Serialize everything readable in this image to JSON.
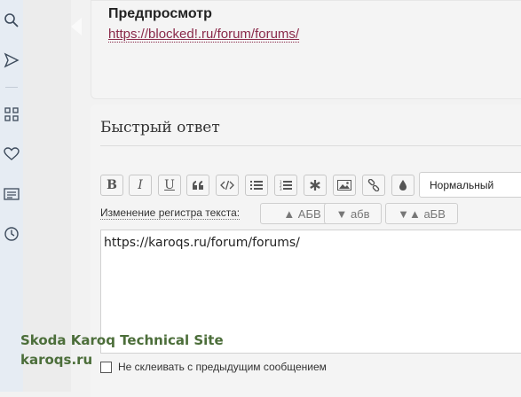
{
  "sidebar": {
    "icons": [
      "search-icon",
      "send-icon",
      "grid-icon",
      "heart-icon",
      "newspaper-icon",
      "clock-icon"
    ]
  },
  "preview": {
    "title": "Предпросмотр",
    "link": "https://blocked!.ru/forum/forums/"
  },
  "quick_reply": {
    "title": "Быстрый ответ",
    "toolbar": {
      "bold": "B",
      "italic": "I",
      "underline": "U",
      "format_select": "Нормальный"
    },
    "case_change_label": "Изменение регистра текста:",
    "case_buttons": [
      "▲ АБВ",
      "▼ абв",
      "▼▲ аБВ"
    ],
    "editor_value": "https://karoqs.ru/forum/forums/",
    "merge_checkbox_label": "Не склеивать с предыдущим сообщением"
  },
  "watermark": {
    "line1": "Skoda Karoq Technical Site",
    "line2": "karoqs.ru"
  },
  "colors": {
    "link": "#8a2a4a",
    "rail_bg": "#e6ecf3",
    "watermark": "#4c6e3a"
  }
}
